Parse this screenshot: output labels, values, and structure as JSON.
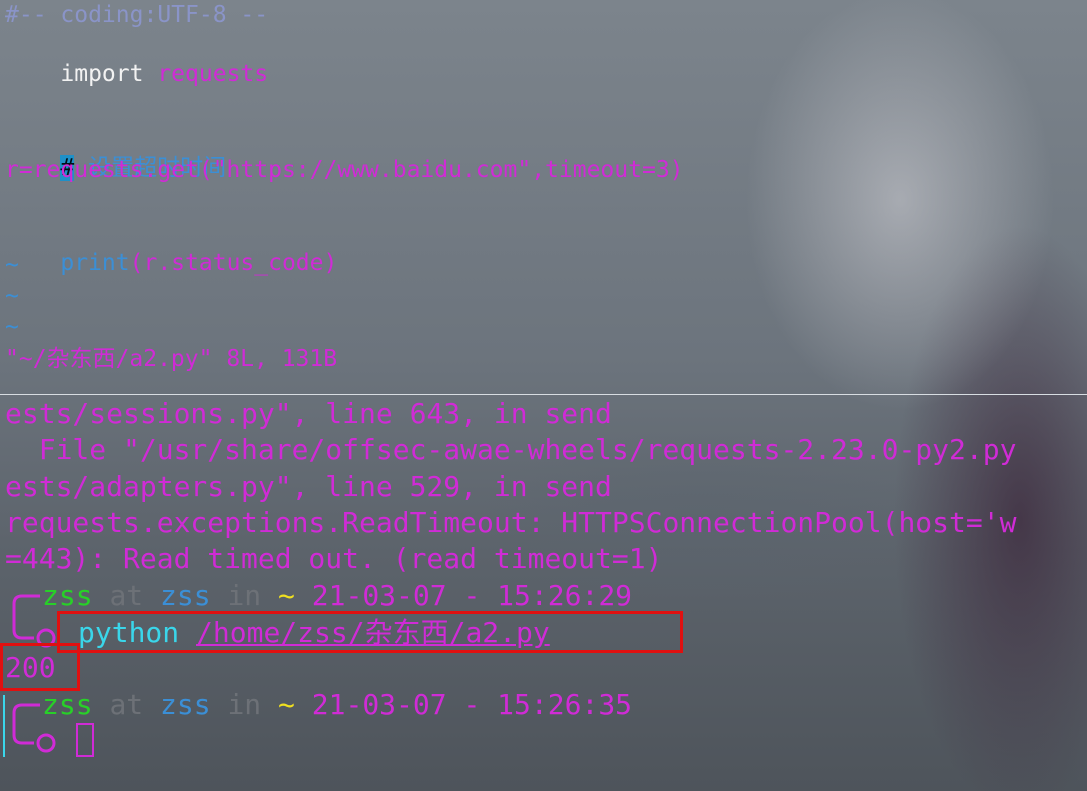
{
  "vim": {
    "line1": "#-- coding:UTF-8 --",
    "line2_kw": "import",
    "line2_mod": " requests",
    "line3_hash": "#",
    "line3_text": " 设置超时时间",
    "line4": "r=requests.get(\"https://www.baidu.com\",timeout=3)",
    "line5_kw": "print",
    "line5_rest": "(r.status_code)",
    "tilde": "~",
    "status": "\"~/杂东西/a2.py\" 8L, 131B"
  },
  "terminal": {
    "tb1": "ests/sessions.py\", line 643, in send",
    "tb2": "  File \"/usr/share/offsec-awae-wheels/requests-2.23.0-py2.py",
    "tb3": "ests/adapters.py\", line 529, in send",
    "tb4": "requests.exceptions.ReadTimeout: HTTPSConnectionPool(host='w",
    "tb5": "=443): Read timed out. (read timeout=1)",
    "prompt1": {
      "user": "zss",
      "at": "at",
      "host": "zss",
      "in": "in",
      "dir": "~",
      "time": "21-03-07 - 15:26:29"
    },
    "command_word": "python",
    "command_path": "/home/zss/杂东西/a2.py",
    "output": "200",
    "prompt2": {
      "user": "zss",
      "at": "at",
      "host": "zss",
      "in": "in",
      "dir": "~",
      "time": "21-03-07 - 15:26:35"
    }
  },
  "colors": {
    "highlight_box": "#e01010",
    "prompt_magenta": "#d02bd6",
    "prompt_green": "#28d028",
    "prompt_blue": "#3b8fd6",
    "prompt_yellow": "#f0e020",
    "command_cyan": "#3ad6ea"
  }
}
